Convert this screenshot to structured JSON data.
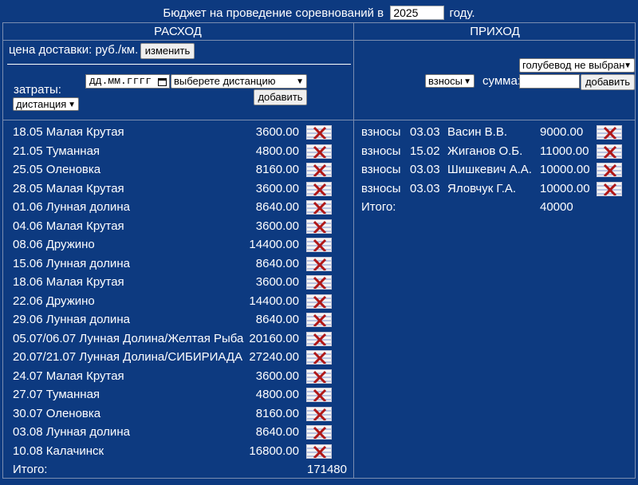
{
  "header": {
    "title_prefix": "Бюджет на проведение соревнований в",
    "year": "2025",
    "title_suffix": "году."
  },
  "expense": {
    "heading": "РАСХОД",
    "delivery_label": "цена доставки: руб./км.",
    "change_button": "изменить",
    "costs_label": "затраты:",
    "date_placeholder": "дд.мм.гггг",
    "distance_select": "выберете дистанцию",
    "type_select": "дистанция",
    "add_button": "добавить",
    "rows": [
      {
        "text": "18.05 Малая Крутая",
        "amount": "3600.00"
      },
      {
        "text": "21.05 Туманная",
        "amount": "4800.00"
      },
      {
        "text": "25.05 Оленовка",
        "amount": "8160.00"
      },
      {
        "text": "28.05 Малая Крутая",
        "amount": "3600.00"
      },
      {
        "text": "01.06 Лунная долина",
        "amount": "8640.00"
      },
      {
        "text": "04.06 Малая Крутая",
        "amount": "3600.00"
      },
      {
        "text": "08.06 Дружино",
        "amount": "14400.00"
      },
      {
        "text": "15.06 Лунная долина",
        "amount": "8640.00"
      },
      {
        "text": "18.06 Малая Крутая",
        "amount": "3600.00"
      },
      {
        "text": "22.06 Дружино",
        "amount": "14400.00"
      },
      {
        "text": "29.06 Лунная долина",
        "amount": "8640.00"
      },
      {
        "text": "05.07/06.07 Лунная Долина/Желтая Рыба",
        "amount": "20160.00"
      },
      {
        "text": "20.07/21.07 Лунная Долина/СИБИРИАДА",
        "amount": "27240.00"
      },
      {
        "text": "24.07 Малая Крутая",
        "amount": "3600.00"
      },
      {
        "text": "27.07 Туманная",
        "amount": "4800.00"
      },
      {
        "text": "30.07 Оленовка",
        "amount": "8160.00"
      },
      {
        "text": "03.08 Лунная долина",
        "amount": "8640.00"
      },
      {
        "text": "10.08 Калачинск",
        "amount": "16800.00"
      }
    ],
    "total_label": "Итого:",
    "total_value": "171480"
  },
  "income": {
    "heading": "ПРИХОД",
    "pigeon_select": "голубевод не выбран",
    "type_select": "взносы",
    "sum_label": "сумма:",
    "add_button": "добавить",
    "rows": [
      {
        "type": "взносы",
        "date": "03.03",
        "name": "Васин В.В.",
        "amount": "9000.00"
      },
      {
        "type": "взносы",
        "date": "15.02",
        "name": "Жиганов О.Б.",
        "amount": "11000.00"
      },
      {
        "type": "взносы",
        "date": "03.03",
        "name": "Шишкевич А.А.",
        "amount": "10000.00"
      },
      {
        "type": "взносы",
        "date": "03.03",
        "name": "Яловчук Г.А.",
        "amount": "10000.00"
      }
    ],
    "total_label": "Итого:",
    "total_value": "40000"
  },
  "colors": {
    "background": "#0d3a80",
    "delete_x": "#b01818"
  },
  "icons": {
    "delete": "delete-x-icon",
    "dropdown": "chevron-down-icon",
    "calendar": "calendar-icon"
  }
}
